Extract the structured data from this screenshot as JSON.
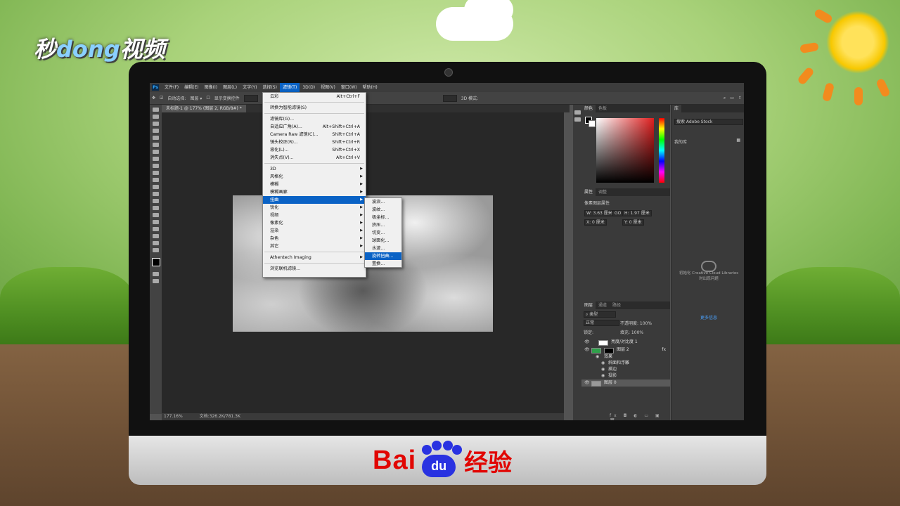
{
  "brand": {
    "watermark": "秒dong视频",
    "watermark_pre": "秒",
    "watermark_mid": "dong",
    "watermark_post": "视频"
  },
  "footer_logo": {
    "bai": "Bai",
    "du": "du",
    "jingyan": "经验"
  },
  "ps": {
    "menubar": [
      "Ps",
      "文件(F)",
      "编辑(E)",
      "图像(I)",
      "图层(L)",
      "文字(Y)",
      "选择(S)",
      "滤镜(T)",
      "3D(D)",
      "视图(V)",
      "窗口(W)",
      "帮助(H)"
    ],
    "active_menu_index": 7,
    "options": {
      "auto_select": "自动选择:",
      "layer": "图层",
      "show_transform": "显示变换控件",
      "mode_3d": "3D 模式:"
    },
    "doc_tab": "未标题-1 @ 177% (图层 2, RGB/8#) *",
    "status": {
      "zoom": "177.16%",
      "doc": "文档:326.2K/781.3K"
    },
    "filter_menu": [
      {
        "label": "云彩",
        "shortcut": "Alt+Ctrl+F"
      },
      {
        "sep": true
      },
      {
        "label": "转换为智能滤镜(S)"
      },
      {
        "sep": true
      },
      {
        "label": "滤镜库(G)..."
      },
      {
        "label": "自适应广角(A)...",
        "shortcut": "Alt+Shift+Ctrl+A"
      },
      {
        "label": "Camera Raw 滤镜(C)...",
        "shortcut": "Shift+Ctrl+A"
      },
      {
        "label": "镜头校正(R)...",
        "shortcut": "Shift+Ctrl+R"
      },
      {
        "label": "液化(L)...",
        "shortcut": "Shift+Ctrl+X"
      },
      {
        "label": "消失点(V)...",
        "shortcut": "Alt+Ctrl+V"
      },
      {
        "sep": true
      },
      {
        "label": "3D",
        "sub": true
      },
      {
        "label": "风格化",
        "sub": true
      },
      {
        "label": "模糊",
        "sub": true
      },
      {
        "label": "模糊画廊",
        "sub": true
      },
      {
        "label": "扭曲",
        "sub": true,
        "highlight": true
      },
      {
        "label": "锐化",
        "sub": true
      },
      {
        "label": "视频",
        "sub": true
      },
      {
        "label": "像素化",
        "sub": true
      },
      {
        "label": "渲染",
        "sub": true
      },
      {
        "label": "杂色",
        "sub": true
      },
      {
        "label": "其它",
        "sub": true
      },
      {
        "sep": true
      },
      {
        "label": "Athentech Imaging",
        "sub": true
      },
      {
        "sep": true
      },
      {
        "label": "浏览联机滤镜..."
      }
    ],
    "distort_submenu": [
      {
        "label": "波浪..."
      },
      {
        "label": "波纹..."
      },
      {
        "label": "极坐标..."
      },
      {
        "label": "挤压..."
      },
      {
        "label": "切变..."
      },
      {
        "label": "球面化..."
      },
      {
        "label": "水波..."
      },
      {
        "label": "旋转扭曲...",
        "highlight": true
      },
      {
        "label": "置换..."
      }
    ],
    "canvas_letter": "T",
    "color_tabs": [
      "颜色",
      "色板"
    ],
    "props_tabs": [
      "属性",
      "调整"
    ],
    "props": {
      "title": "像素图层属性",
      "w": "W: 3.63 厘米",
      "h": "H: 1.97 厘米",
      "x": "X: 0 厘米",
      "y": "Y: 0 厘米",
      "link": "GO"
    },
    "layers_tabs": [
      "图层",
      "通道",
      "路径"
    ],
    "layers": {
      "kind": "类型",
      "blend": "正常",
      "opacity": "不透明度: 100%",
      "lock": "锁定:",
      "fill": "填充: 100%",
      "rows": [
        {
          "name": "亮度/对比度 1"
        },
        {
          "name": "图层 2",
          "fx": "fx"
        },
        {
          "name": "效果"
        },
        {
          "name": "斜面和浮雕"
        },
        {
          "name": "描边"
        },
        {
          "name": "投影"
        },
        {
          "name": "图层 0"
        }
      ]
    },
    "lib": {
      "tab": "库",
      "search": "搜索 Adobe Stock",
      "dropdown": "我的库",
      "message": "初始化 Creative Cloud Libraries 时出现问题",
      "link": "更多信息"
    }
  },
  "colors": {
    "accent": "#0a62c5",
    "ps_bg": "#535353",
    "baidu_red": "#e10602",
    "baidu_blue": "#2932e1"
  }
}
